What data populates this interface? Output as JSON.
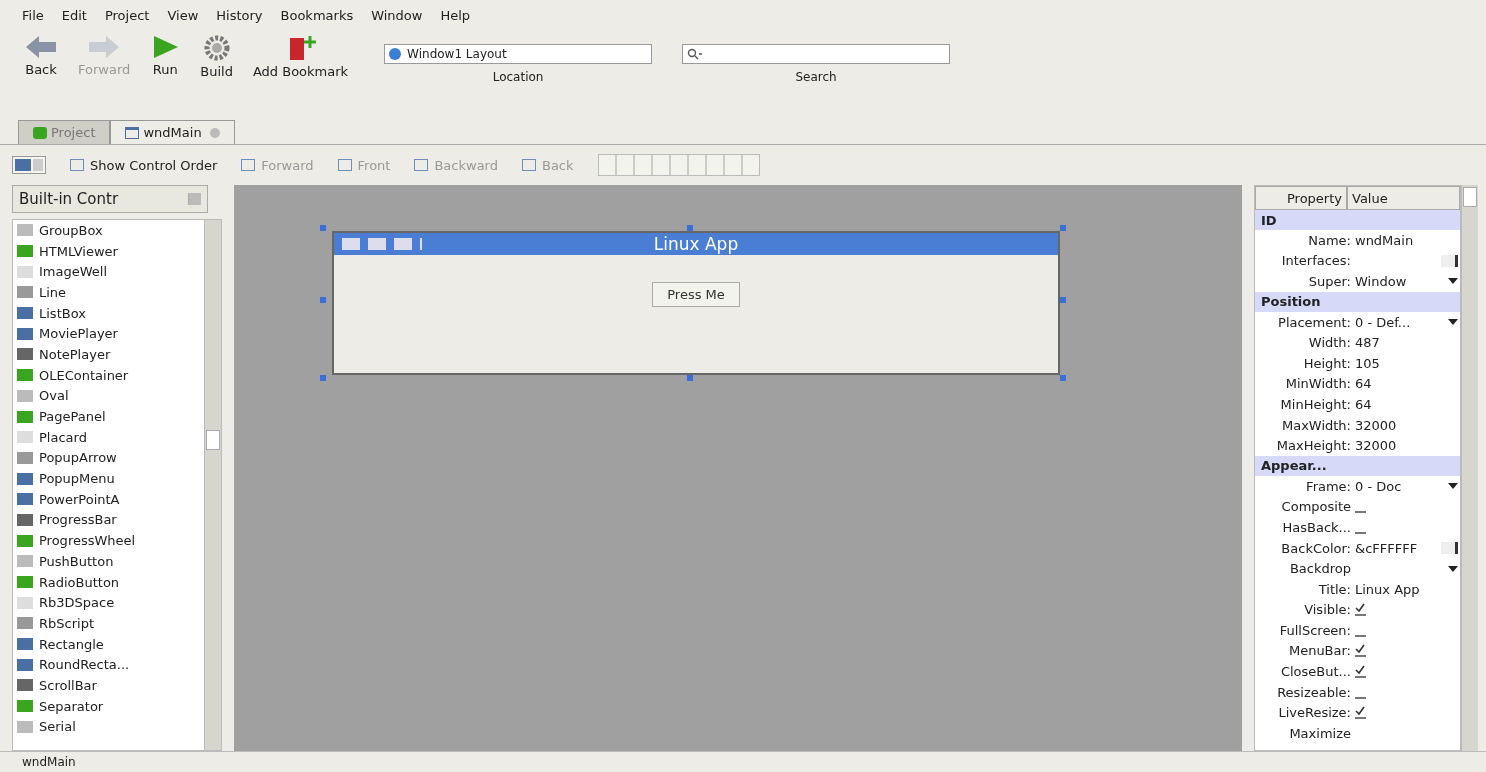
{
  "menu": [
    "File",
    "Edit",
    "Project",
    "View",
    "History",
    "Bookmarks",
    "Window",
    "Help"
  ],
  "toolbar": [
    {
      "label": "Back",
      "kind": "back",
      "disabled": false
    },
    {
      "label": "Forward",
      "kind": "forward",
      "disabled": true
    },
    {
      "label": "Run",
      "kind": "run",
      "disabled": false
    },
    {
      "label": "Build",
      "kind": "build",
      "disabled": false
    },
    {
      "label": "Add Bookmark",
      "kind": "bookmark",
      "disabled": false
    }
  ],
  "location": {
    "value": "Window1 Layout",
    "label": "Location"
  },
  "search": {
    "label": "Search"
  },
  "tabs": [
    {
      "label": "Project",
      "selected": false,
      "closable": false
    },
    {
      "label": "wndMain",
      "selected": true,
      "closable": true
    }
  ],
  "layout_toolbar": [
    {
      "label": "Show Control Order",
      "disabled": false
    },
    {
      "label": "Forward",
      "disabled": true
    },
    {
      "label": "Front",
      "disabled": true
    },
    {
      "label": "Backward",
      "disabled": true
    },
    {
      "label": "Back",
      "disabled": true
    }
  ],
  "controls": {
    "dropdown": "Built-in Contr",
    "items": [
      "GroupBox",
      "HTMLViewer",
      "ImageWell",
      "Line",
      "ListBox",
      "MoviePlayer",
      "NotePlayer",
      "OLEContainer",
      "Oval",
      "PagePanel",
      "Placard",
      "PopupArrow",
      "PopupMenu",
      "PowerPointA",
      "ProgressBar",
      "ProgressWheel",
      "PushButton",
      "RadioButton",
      "Rb3DSpace",
      "RbScript",
      "Rectangle",
      "RoundRecta...",
      "ScrollBar",
      "Separator",
      "Serial"
    ]
  },
  "canvas": {
    "window_title": "Linux App",
    "button": "Press Me"
  },
  "properties": {
    "columns": [
      "Property",
      "Value"
    ],
    "rows": [
      {
        "kind": "section",
        "name": "ID"
      },
      {
        "kind": "text",
        "name": "Name:",
        "value": "wndMain"
      },
      {
        "kind": "color",
        "name": "Interfaces:",
        "value": ""
      },
      {
        "kind": "popup",
        "name": "Super:",
        "value": "Window"
      },
      {
        "kind": "section",
        "name": "Position"
      },
      {
        "kind": "popup",
        "name": "Placement:",
        "value": "0 - Def..."
      },
      {
        "kind": "text",
        "name": "Width:",
        "value": "487"
      },
      {
        "kind": "text",
        "name": "Height:",
        "value": "105"
      },
      {
        "kind": "text",
        "name": "MinWidth:",
        "value": "64"
      },
      {
        "kind": "text",
        "name": "MinHeight:",
        "value": "64"
      },
      {
        "kind": "text",
        "name": "MaxWidth:",
        "value": "32000"
      },
      {
        "kind": "text",
        "name": "MaxHeight:",
        "value": "32000"
      },
      {
        "kind": "section",
        "name": "Appear..."
      },
      {
        "kind": "popup",
        "name": "Frame:",
        "value": "0 - Doc"
      },
      {
        "kind": "check",
        "name": "Composite",
        "checked": false
      },
      {
        "kind": "check",
        "name": "HasBack...",
        "checked": false
      },
      {
        "kind": "color",
        "name": "BackColor:",
        "value": "&cFFFFFF"
      },
      {
        "kind": "popup",
        "name": "Backdrop",
        "value": ""
      },
      {
        "kind": "text",
        "name": "Title:",
        "value": "Linux App"
      },
      {
        "kind": "check",
        "name": "Visible:",
        "checked": true
      },
      {
        "kind": "check",
        "name": "FullScreen:",
        "checked": false
      },
      {
        "kind": "check",
        "name": "MenuBar:",
        "checked": true
      },
      {
        "kind": "check",
        "name": "CloseBut...",
        "checked": true
      },
      {
        "kind": "check",
        "name": "Resizeable:",
        "checked": false
      },
      {
        "kind": "check",
        "name": "LiveResize:",
        "checked": true
      },
      {
        "kind": "text",
        "name": "Maximize",
        "value": ""
      }
    ]
  },
  "status_bar": "wndMain"
}
